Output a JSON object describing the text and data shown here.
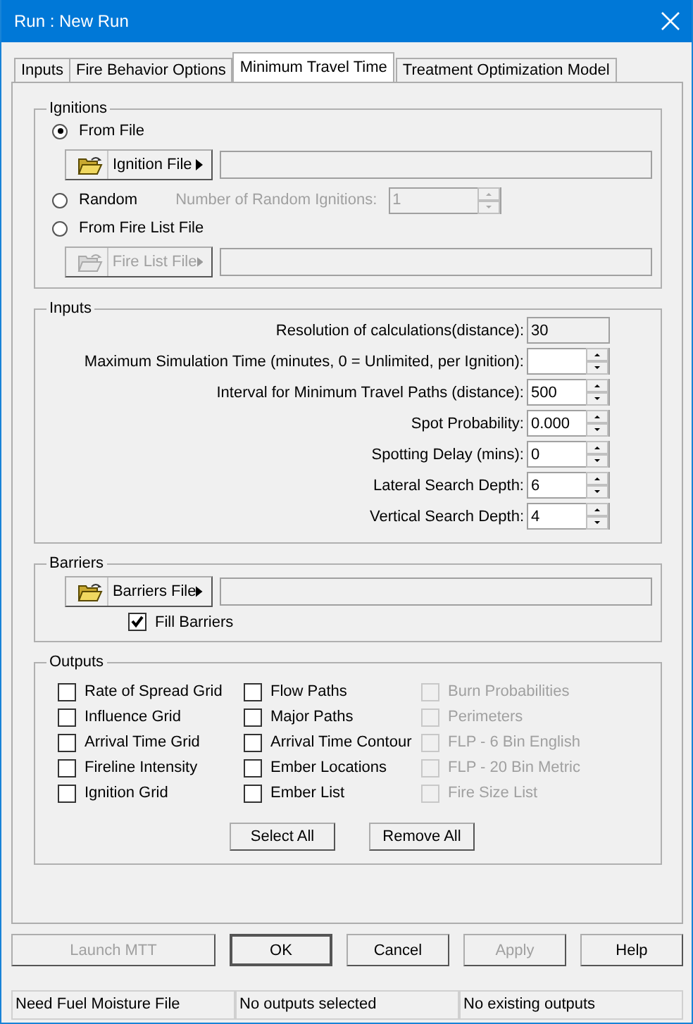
{
  "window": {
    "title": "Run : New Run"
  },
  "tabs": [
    {
      "label": "Inputs",
      "selected": false
    },
    {
      "label": "Fire Behavior Options",
      "selected": false
    },
    {
      "label": "Minimum Travel Time",
      "selected": true
    },
    {
      "label": "Treatment Optimization Model",
      "selected": false
    }
  ],
  "ignitions": {
    "title": "Ignitions",
    "options": [
      {
        "kind": "file",
        "label": "From File",
        "selected": true,
        "button": {
          "label": "Ignition File",
          "disabled": false
        }
      },
      {
        "kind": "random",
        "label": "Random",
        "selected": false,
        "field": {
          "label": "Number of Random Ignitions:",
          "value": "1",
          "disabled": true
        }
      },
      {
        "kind": "file",
        "label": "From Fire List File",
        "selected": false,
        "button": {
          "label": "Fire List File",
          "disabled": true
        }
      }
    ]
  },
  "inputs": {
    "title": "Inputs",
    "fields": [
      {
        "kind": "readonly",
        "label": "Resolution of calculations(distance):",
        "value": "30"
      },
      {
        "kind": "spin",
        "label": "Maximum Simulation Time (minutes, 0 = Unlimited, per Ignition):"
      },
      {
        "kind": "spin",
        "label": "Interval for Minimum Travel Paths (distance):",
        "value": "500"
      },
      {
        "kind": "spin",
        "label": "Spot Probability:",
        "value": "0.000"
      },
      {
        "kind": "spin",
        "label": "Spotting Delay (mins):",
        "value": "0"
      },
      {
        "kind": "spin",
        "label": "Lateral Search Depth:",
        "value": "6"
      },
      {
        "kind": "spin",
        "label": "Vertical Search Depth:",
        "value": "4"
      }
    ]
  },
  "barriers": {
    "title": "Barriers",
    "button": {
      "label": "Barriers File",
      "disabled": false
    },
    "fill": {
      "label": "Fill Barriers",
      "checked": true
    }
  },
  "outputs": {
    "title": "Outputs",
    "columns": [
      [
        {
          "label": "Rate of Spread Grid",
          "checked": false,
          "disabled": false
        },
        {
          "label": "Influence Grid",
          "checked": false,
          "disabled": false
        },
        {
          "label": "Arrival Time Grid",
          "checked": false,
          "disabled": false
        },
        {
          "label": "Fireline Intensity",
          "checked": false,
          "disabled": false
        },
        {
          "label": "Ignition Grid",
          "checked": false,
          "disabled": false
        }
      ],
      [
        {
          "label": "Flow Paths",
          "checked": false,
          "disabled": false
        },
        {
          "label": "Major Paths",
          "checked": false,
          "disabled": false
        },
        {
          "label": "Arrival Time Contour",
          "checked": false,
          "disabled": false
        },
        {
          "label": "Ember Locations",
          "checked": false,
          "disabled": false
        },
        {
          "label": "Ember List",
          "checked": false,
          "disabled": false
        }
      ],
      [
        {
          "label": "Burn Probabilities",
          "checked": false,
          "disabled": true
        },
        {
          "label": "Perimeters",
          "checked": false,
          "disabled": true
        },
        {
          "label": "FLP - 6 Bin English",
          "checked": false,
          "disabled": true
        },
        {
          "label": "FLP - 20 Bin Metric",
          "checked": false,
          "disabled": true
        },
        {
          "label": "Fire Size List",
          "checked": false,
          "disabled": true
        }
      ]
    ],
    "buttons": [
      "Select All",
      "Remove All"
    ]
  },
  "dialog_buttons": [
    {
      "label": "Launch MTT",
      "disabled": true,
      "default": false
    },
    {
      "label": "OK",
      "disabled": false,
      "default": true
    },
    {
      "label": "Cancel",
      "disabled": false,
      "default": false
    },
    {
      "label": "Apply",
      "disabled": true,
      "default": false
    },
    {
      "label": "Help",
      "disabled": false,
      "default": false
    }
  ],
  "status_bar": [
    "Need Fuel Moisture File",
    "No outputs selected",
    "No existing outputs"
  ]
}
